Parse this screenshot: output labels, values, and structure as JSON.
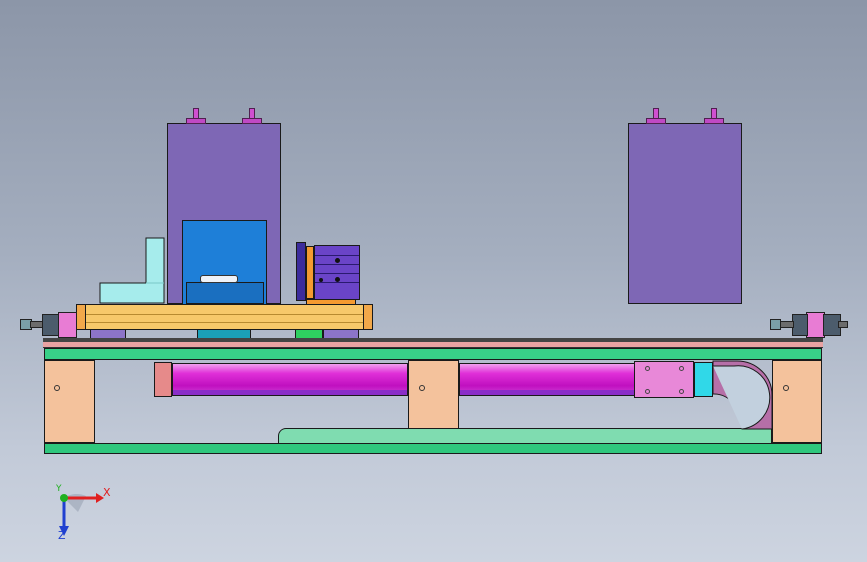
{
  "viewport": {
    "background_top": "#8c96a8",
    "background_bottom": "#cdd4e0"
  },
  "model": {
    "components": [
      {
        "name": "left-motor-housing",
        "color": "#7e67b5"
      },
      {
        "name": "right-motor-housing",
        "color": "#7e67b5"
      },
      {
        "name": "blue-clamp-block",
        "color": "#1e7fd8"
      },
      {
        "name": "carriage-plate",
        "color": "#f7c86a"
      },
      {
        "name": "top-rail",
        "color": "#38d188"
      },
      {
        "name": "bottom-rail",
        "color": "#2fc77d"
      },
      {
        "name": "pneumatic-cylinder",
        "color": "#e030d8"
      },
      {
        "name": "support-block",
        "color": "#f4c29c"
      },
      {
        "name": "cable-chain",
        "color": "#b66fa8"
      },
      {
        "name": "cable-track",
        "color": "#7fdcb0"
      }
    ]
  },
  "triad": {
    "x_label": "X",
    "y_label": "Y",
    "z_label": "Z",
    "x_color": "#e02020",
    "y_color": "#20b020",
    "z_color": "#2040d0"
  }
}
